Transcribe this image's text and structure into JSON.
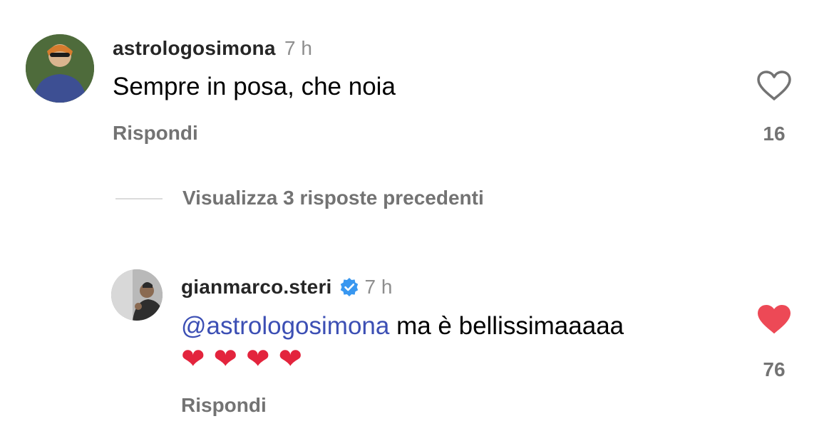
{
  "comments": [
    {
      "username": "astrologosimona",
      "time": "7 h",
      "text": "Sempre in posa, che noia",
      "reply_label": "Rispondi",
      "like_count": "16",
      "liked": false
    },
    {
      "username": "gianmarco.steri",
      "verified": true,
      "time": "7 h",
      "mention": "@astrologosimona",
      "text": " ma è bellissimaaaaa",
      "hearts": [
        "❤",
        "❤",
        "❤",
        "❤"
      ],
      "reply_label": "Rispondi",
      "like_count": "76",
      "liked": true
    }
  ],
  "view_replies": "Visualizza 3 risposte precedenti",
  "colors": {
    "mention": "#3c4fb4",
    "verified": "#3897f0",
    "heart_active": "#ed4956",
    "muted": "#737373"
  },
  "icons": [
    "heart-outline-icon",
    "heart-filled-icon",
    "verified-badge-icon",
    "red-heart-emoji"
  ]
}
